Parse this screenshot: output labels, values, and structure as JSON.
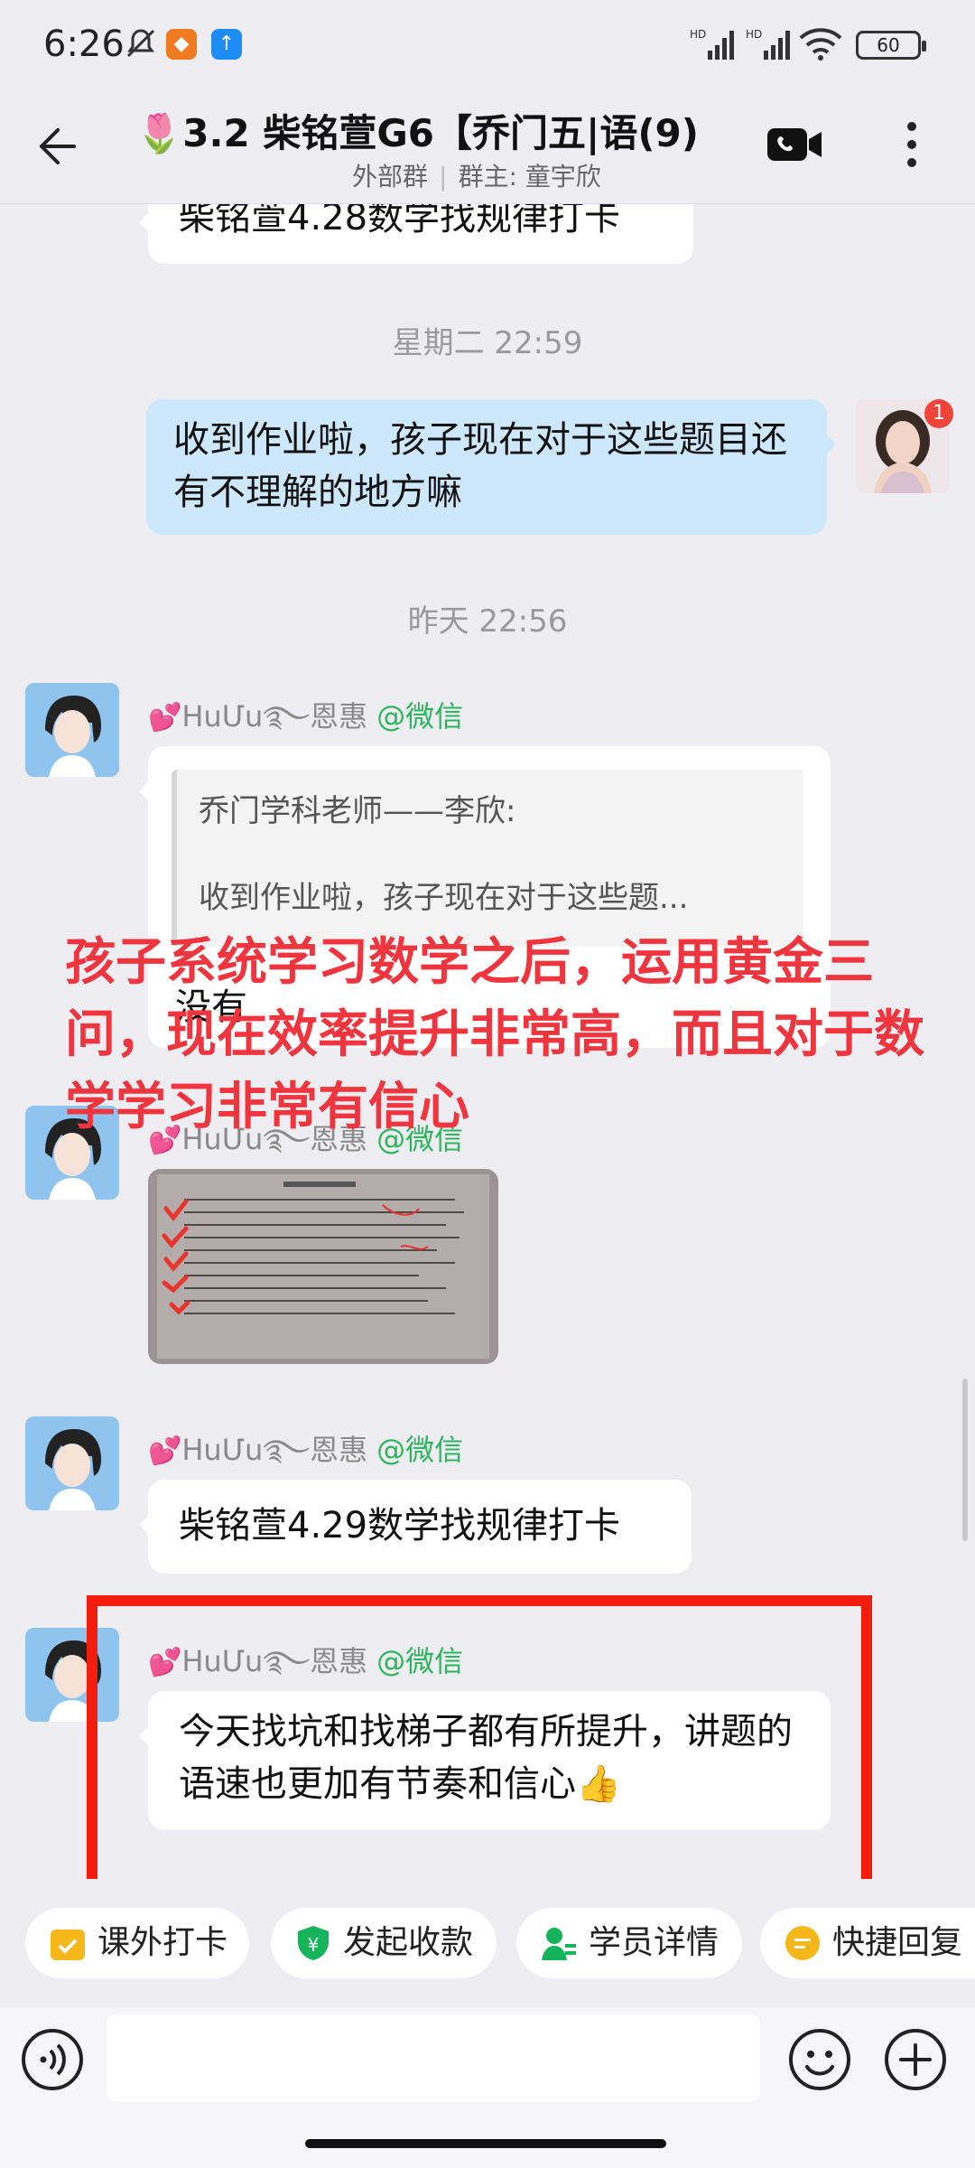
{
  "status_bar": {
    "time": "6:26",
    "battery": "60",
    "signal_label": "HD"
  },
  "header": {
    "title": "🌷3.2 柴铭萱G6【乔门五|语",
    "member_count": "(9)",
    "group_type": "外部群",
    "owner_label": "群主: 童宇欣"
  },
  "messages": {
    "top_partial": "柴铭萱4.28数学找规律打卡",
    "ts1": "星期二  22:59",
    "mine_text": "收到作业啦，孩子现在对于这些题目还有不理解的地方嘛",
    "mine_avatar_badge": "1",
    "ts2": "昨天  22:56",
    "sender_name": "HuՄu<u>ঌ</u>恩惠",
    "sender_name_plain": "HuՄu࿐恩惠",
    "sender_source": "@微信",
    "quote_author": "乔门学科老师——李欣:",
    "quote_text": "收到作业啦，孩子现在对于这些题...",
    "reply_text": "没有",
    "msg3_text": "柴铭萱4.29数学找规律打卡",
    "msg4_text": "今天找坑和找梯子都有所提升，讲题的语速也更加有节奏和信心👍"
  },
  "overlay_note": "孩子系统学习数学之后，运用黄金三问，现在效率提升非常高，而且对于数学学习非常有信心",
  "quick_actions": [
    {
      "label": "课外打卡",
      "color": "#f5b71a"
    },
    {
      "label": "发起收款",
      "color": "#16b45a"
    },
    {
      "label": "学员详情",
      "color": "#16b45a"
    },
    {
      "label": "快捷回复",
      "color": "#f5b71a"
    }
  ],
  "input": {
    "placeholder": ""
  }
}
